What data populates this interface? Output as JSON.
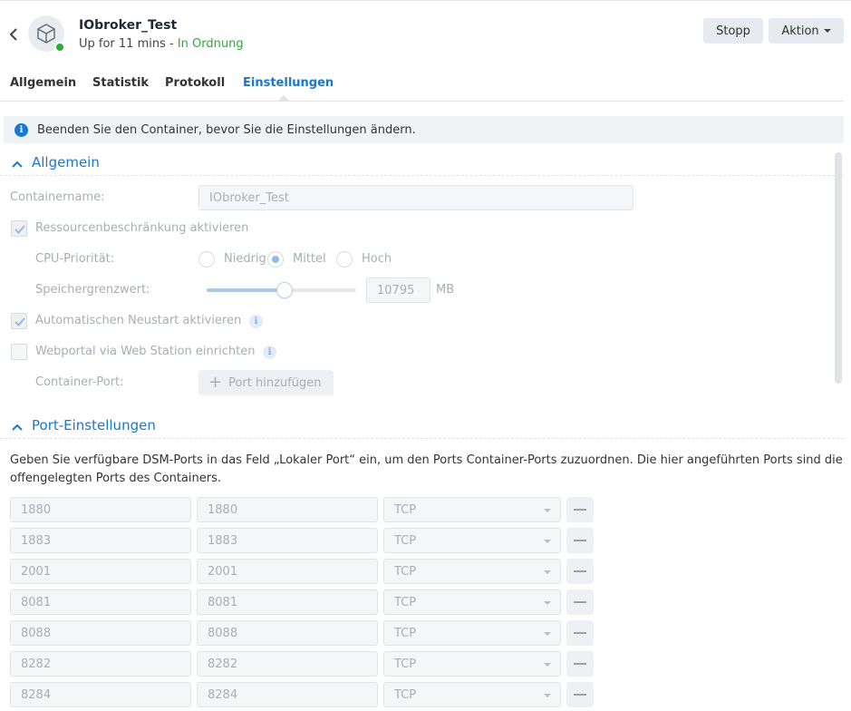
{
  "header": {
    "title": "IObroker_Test",
    "uptime": "Up for 11 mins - ",
    "status": "In Ordnung",
    "stop_label": "Stopp",
    "action_label": "Aktion"
  },
  "tabs": [
    {
      "label": "Allgemein"
    },
    {
      "label": "Statistik"
    },
    {
      "label": "Protokoll"
    },
    {
      "label": "Einstellungen"
    }
  ],
  "info_bar": {
    "text": "Beenden Sie den Container, bevor Sie die Einstellungen ändern."
  },
  "general": {
    "section_title": "Allgemein",
    "container_name_label": "Containername:",
    "container_name_value": "IObroker_Test",
    "resource_limit_label": "Ressourcenbeschränkung aktivieren",
    "cpu_priority_label": "CPU-Priorität:",
    "cpu_options": [
      "Niedrig",
      "Mittel",
      "Hoch"
    ],
    "cpu_selected": "Mittel",
    "memory_limit_label": "Speichergrenzwert:",
    "memory_value": "10795",
    "memory_unit": "MB",
    "memory_slider_fraction": 0.52,
    "auto_restart_label": "Automatischen Neustart aktivieren",
    "webportal_label": "Webportal via Web Station einrichten",
    "container_port_label": "Container-Port:",
    "add_port_label": "Port hinzufügen"
  },
  "port_settings": {
    "section_title": "Port-Einstellungen",
    "description": "Geben Sie verfügbare DSM-Ports in das Feld „Lokaler Port“ ein, um den Ports Container-Ports zuzuordnen. Die hier angeführten Ports sind die offengelegten Ports des Containers.",
    "rows": [
      {
        "local": "1880",
        "container": "1880",
        "protocol": "TCP"
      },
      {
        "local": "1883",
        "container": "1883",
        "protocol": "TCP"
      },
      {
        "local": "2001",
        "container": "2001",
        "protocol": "TCP"
      },
      {
        "local": "8081",
        "container": "8081",
        "protocol": "TCP"
      },
      {
        "local": "8088",
        "container": "8088",
        "protocol": "TCP"
      },
      {
        "local": "8282",
        "container": "8282",
        "protocol": "TCP"
      },
      {
        "local": "8284",
        "container": "8284",
        "protocol": "TCP"
      }
    ]
  },
  "colors": {
    "accent": "#1a77d2",
    "status_ok": "#2bab3a"
  },
  "icons": {
    "back": "chevron-left-icon",
    "app": "cube-icon",
    "info": "info-icon",
    "hint": "info-hint-icon",
    "section_toggle": "chevron-up-icon",
    "add": "plus-icon",
    "remove": "minus-icon"
  }
}
